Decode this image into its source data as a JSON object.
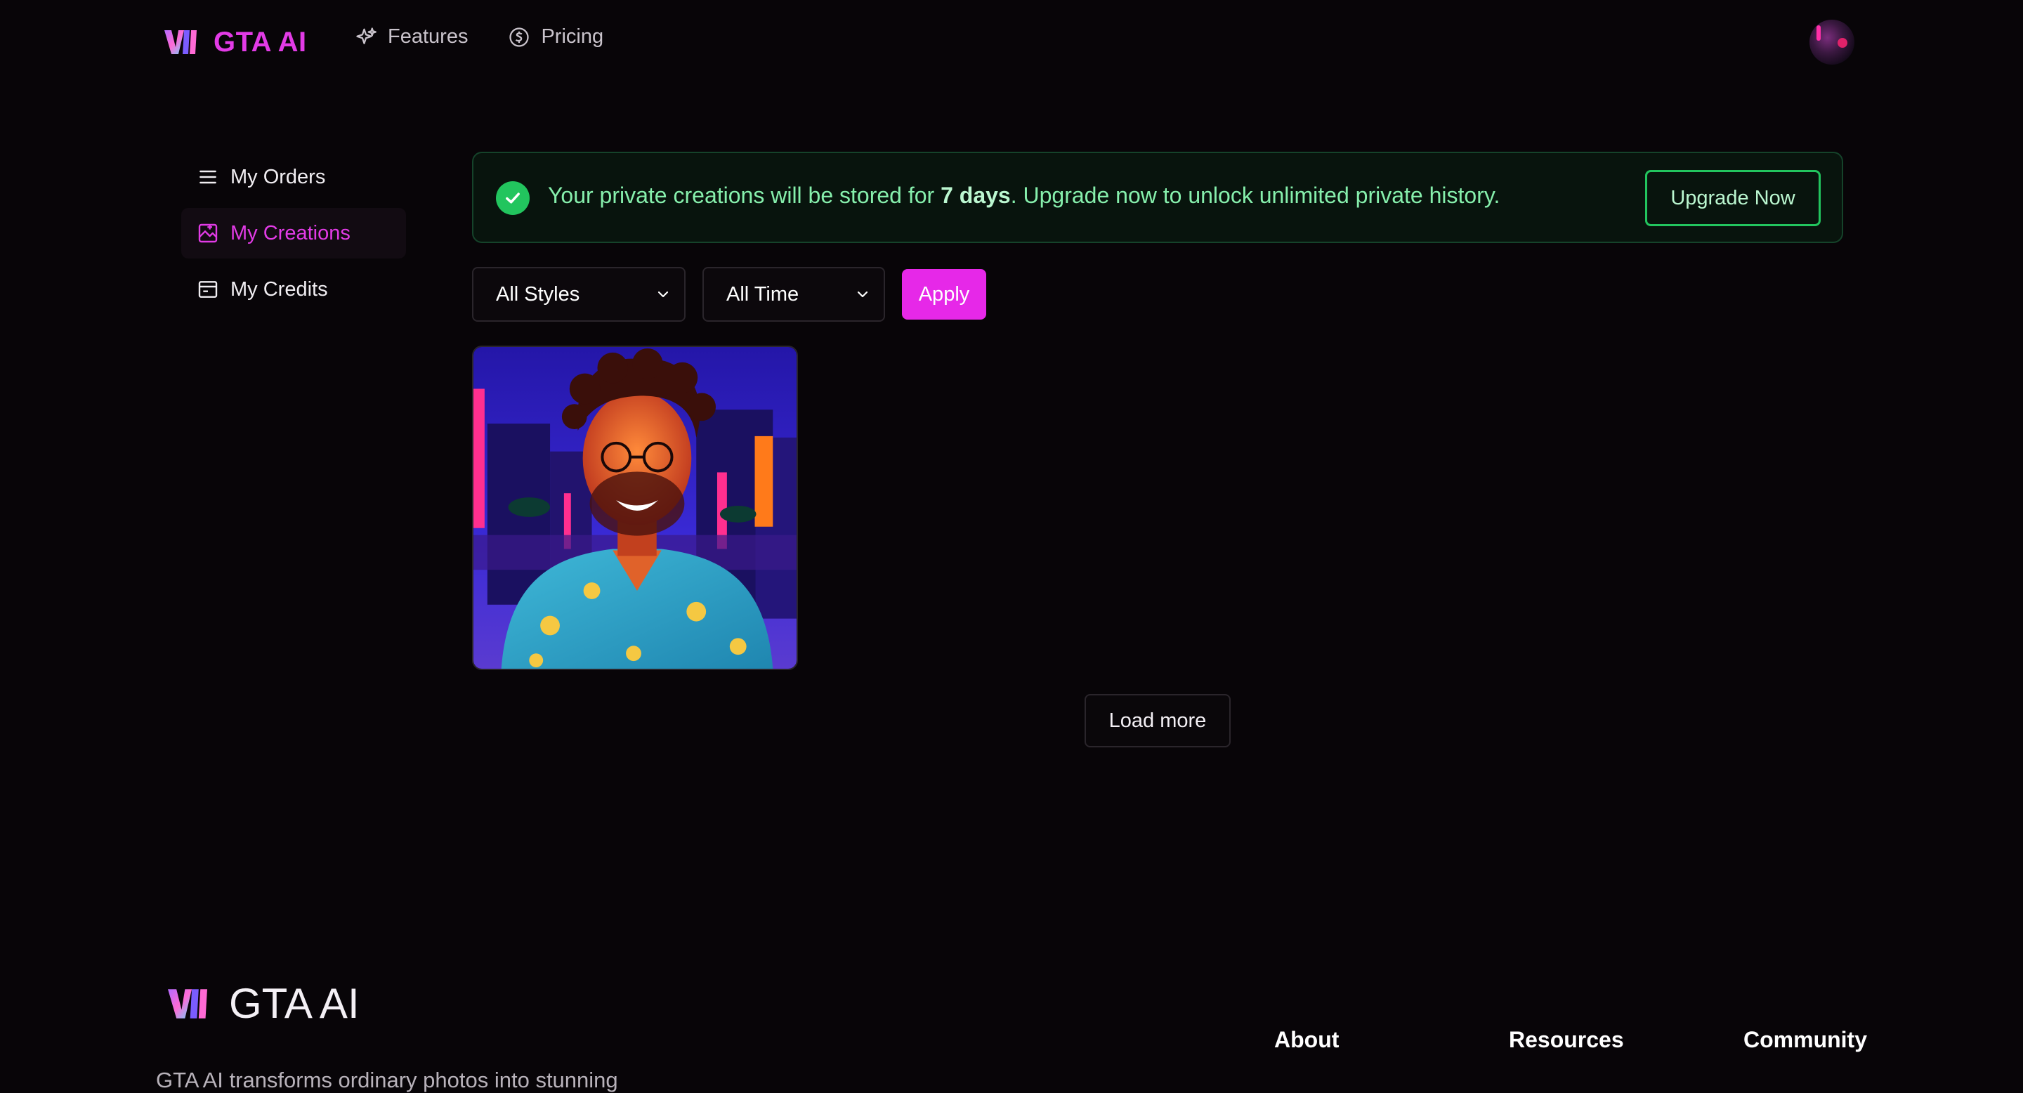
{
  "header": {
    "brand_name": "GTA AI",
    "nav": [
      {
        "label": "Features",
        "icon": "sparkles-icon"
      },
      {
        "label": "Pricing",
        "icon": "dollar-circle-icon"
      }
    ],
    "avatar_icon": "user-avatar"
  },
  "sidebar": {
    "items": [
      {
        "label": "My Orders",
        "icon": "list-icon",
        "active": false
      },
      {
        "label": "My Creations",
        "icon": "gallery-icon",
        "active": true
      },
      {
        "label": "My Credits",
        "icon": "wallet-icon",
        "active": false
      }
    ]
  },
  "notice": {
    "text_before": "Your private creations will be stored for ",
    "text_bold": "7 days",
    "text_after": ". Upgrade now to unlock unlimited private history.",
    "button_label": "Upgrade Now"
  },
  "filters": {
    "style_selected": "All Styles",
    "time_selected": "All Time",
    "apply_label": "Apply"
  },
  "gallery": {
    "load_more_label": "Load more"
  },
  "footer": {
    "brand_name": "GTA AI",
    "description": "GTA AI transforms ordinary photos into stunning",
    "columns": [
      "About",
      "Resources",
      "Community"
    ]
  },
  "colors": {
    "accent": "#e23be6",
    "success": "#22c55e",
    "background": "#080508"
  }
}
